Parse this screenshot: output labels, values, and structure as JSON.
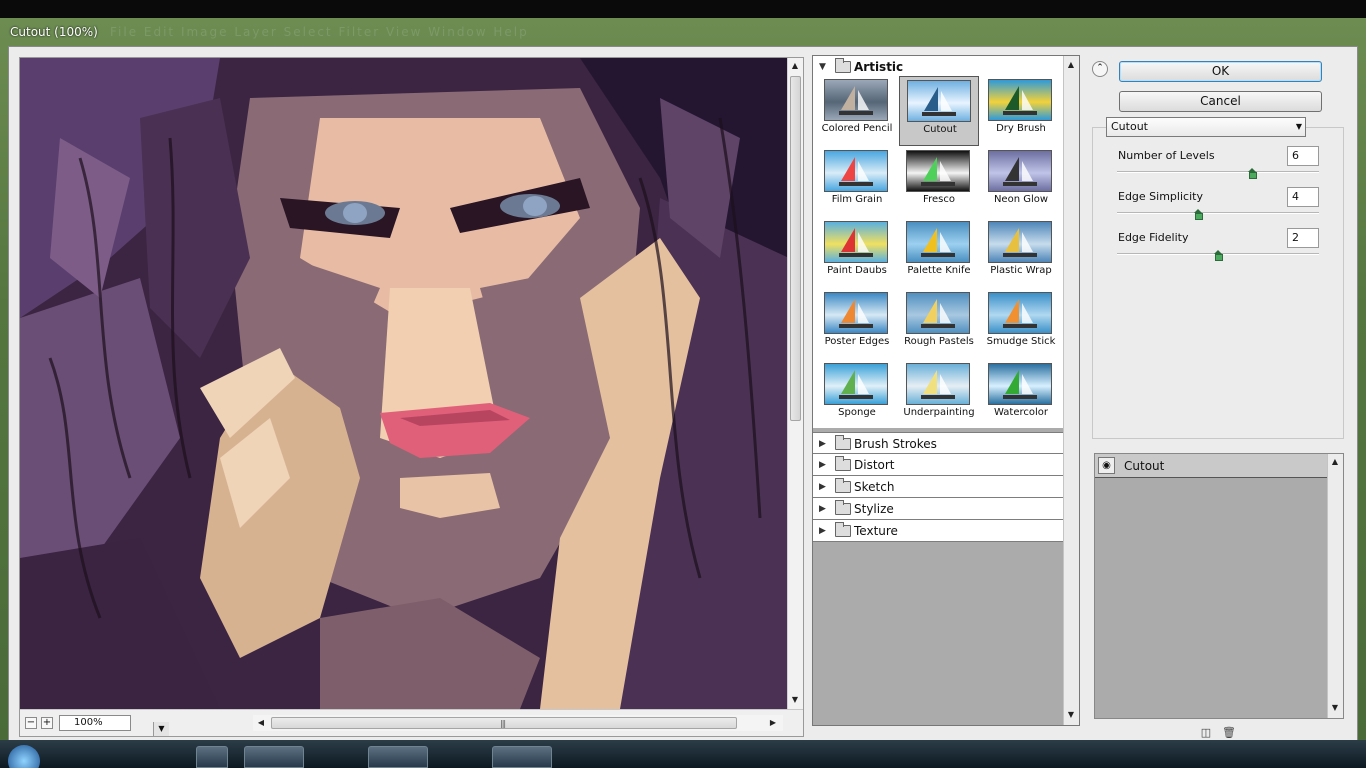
{
  "window": {
    "title": "Cutout (100%)",
    "menu_ghost": "File  Edit  Image  Layer  Select  Filter  View  Window  Help"
  },
  "preview": {
    "zoom_value": "100%",
    "zoom_minus": "−",
    "zoom_plus": "+"
  },
  "gallery": {
    "open_category": "Artistic",
    "filters": [
      {
        "label": "Colored Pencil",
        "selected": false
      },
      {
        "label": "Cutout",
        "selected": true
      },
      {
        "label": "Dry Brush",
        "selected": false
      },
      {
        "label": "Film Grain",
        "selected": false
      },
      {
        "label": "Fresco",
        "selected": false
      },
      {
        "label": "Neon Glow",
        "selected": false
      },
      {
        "label": "Paint Daubs",
        "selected": false
      },
      {
        "label": "Palette Knife",
        "selected": false
      },
      {
        "label": "Plastic Wrap",
        "selected": false
      },
      {
        "label": "Poster Edges",
        "selected": false
      },
      {
        "label": "Rough Pastels",
        "selected": false
      },
      {
        "label": "Smudge Stick",
        "selected": false
      },
      {
        "label": "Sponge",
        "selected": false
      },
      {
        "label": "Underpainting",
        "selected": false
      },
      {
        "label": "Watercolor",
        "selected": false
      }
    ],
    "closed_categories": [
      "Brush Strokes",
      "Distort",
      "Sketch",
      "Stylize",
      "Texture"
    ]
  },
  "buttons": {
    "ok": "OK",
    "cancel": "Cancel"
  },
  "settings": {
    "filter_select": "Cutout",
    "params": [
      {
        "label": "Number of Levels",
        "value": "6",
        "fraction": 0.67
      },
      {
        "label": "Edge Simplicity",
        "value": "4",
        "fraction": 0.4
      },
      {
        "label": "Edge Fidelity",
        "value": "2",
        "fraction": 0.5
      }
    ]
  },
  "layers": {
    "items": [
      {
        "name": "Cutout"
      }
    ]
  },
  "colors": {
    "window_green": "#55763f",
    "dialog_bg": "#ececec",
    "panel_gray": "#ababab",
    "slider_green": "#4caa5e"
  }
}
